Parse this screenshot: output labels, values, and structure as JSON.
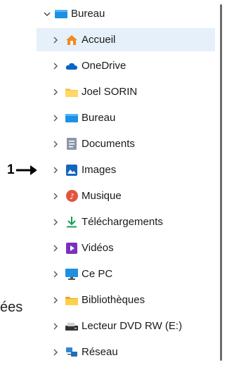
{
  "annotation": {
    "number": "1"
  },
  "clipped_text": "ées",
  "tree": {
    "root": {
      "label": "Bureau",
      "icon": "desktop-icon",
      "expanded": true
    },
    "items": [
      {
        "label": "Accueil",
        "icon": "home-icon",
        "selected": true
      },
      {
        "label": "OneDrive",
        "icon": "cloud-icon"
      },
      {
        "label": "Joel SORIN",
        "icon": "folder-icon"
      },
      {
        "label": "Bureau",
        "icon": "desktop-icon"
      },
      {
        "label": "Documents",
        "icon": "document-icon"
      },
      {
        "label": "Images",
        "icon": "image-icon"
      },
      {
        "label": "Musique",
        "icon": "music-icon"
      },
      {
        "label": "Téléchargements",
        "icon": "download-icon"
      },
      {
        "label": "Vidéos",
        "icon": "video-icon"
      },
      {
        "label": "Ce PC",
        "icon": "computer-icon"
      },
      {
        "label": "Bibliothèques",
        "icon": "library-folder-icon"
      },
      {
        "label": "Lecteur DVD RW (E:)",
        "icon": "dvd-drive-icon"
      },
      {
        "label": "Réseau",
        "icon": "network-icon"
      }
    ]
  },
  "colors": {
    "selected_bg": "#e6f0fa",
    "accent": "#0078d4",
    "folder": "#f6c343"
  }
}
